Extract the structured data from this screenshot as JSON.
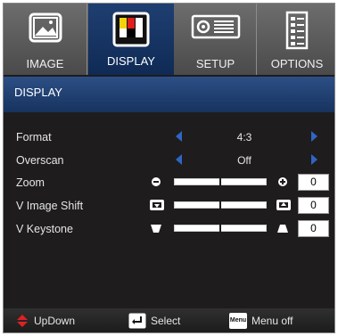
{
  "tabs": [
    {
      "label": "IMAGE",
      "icon": "image-icon",
      "active": false
    },
    {
      "label": "DISPLAY",
      "icon": "display-icon",
      "active": true
    },
    {
      "label": "SETUP",
      "icon": "projector-icon",
      "active": false
    },
    {
      "label": "OPTIONS",
      "icon": "options-icon",
      "active": false
    }
  ],
  "header": {
    "title": "DISPLAY"
  },
  "rows": {
    "format": {
      "label": "Format",
      "value": "4:3"
    },
    "overscan": {
      "label": "Overscan",
      "value": "Off"
    },
    "zoom": {
      "label": "Zoom",
      "value": "0",
      "level": 0.5
    },
    "v_image_shift": {
      "label": "V Image Shift",
      "value": "0",
      "level": 0.5
    },
    "v_keystone": {
      "label": "V Keystone",
      "value": "0",
      "level": 0.5
    }
  },
  "footer": {
    "updown_label": "UpDown",
    "select_label": "Select",
    "menu_key": "Menu",
    "menu_label": "Menu off"
  },
  "colors": {
    "accent": "#2f66c4",
    "active_tab": "#1f3f72",
    "background": "#1e1c1d"
  }
}
